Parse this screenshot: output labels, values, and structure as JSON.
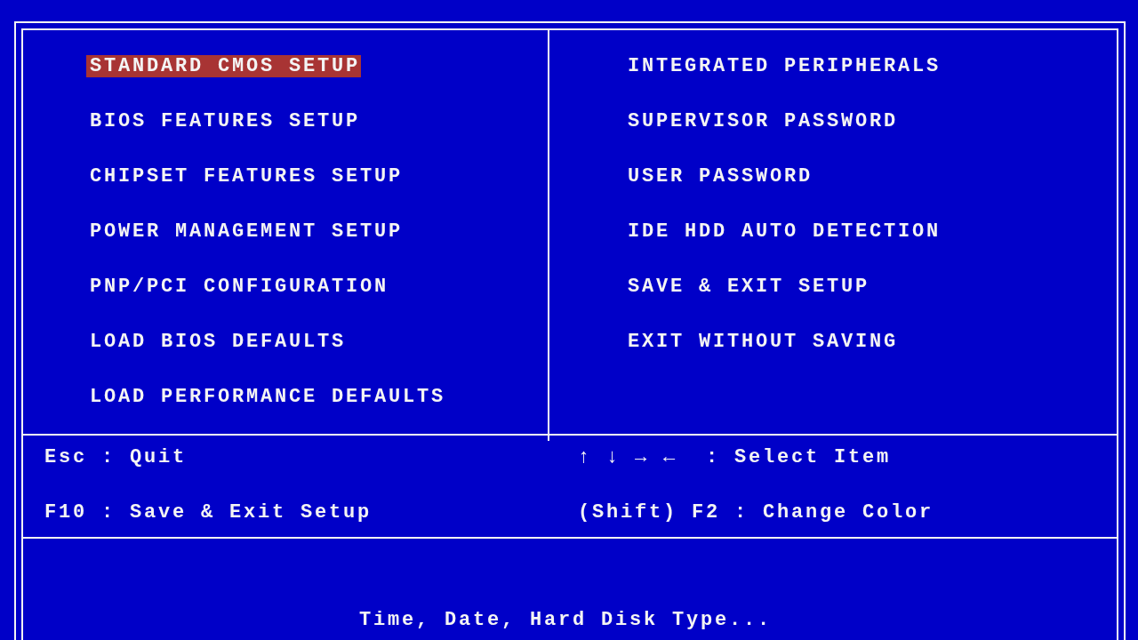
{
  "menu": {
    "left": [
      {
        "label": "STANDARD CMOS SETUP",
        "selected": true
      },
      {
        "label": "BIOS FEATURES SETUP",
        "selected": false
      },
      {
        "label": "CHIPSET FEATURES SETUP",
        "selected": false
      },
      {
        "label": "POWER MANAGEMENT SETUP",
        "selected": false
      },
      {
        "label": "PNP/PCI CONFIGURATION",
        "selected": false
      },
      {
        "label": "LOAD BIOS DEFAULTS",
        "selected": false
      },
      {
        "label": "LOAD PERFORMANCE DEFAULTS",
        "selected": false
      }
    ],
    "right": [
      {
        "label": "INTEGRATED PERIPHERALS",
        "selected": false
      },
      {
        "label": "SUPERVISOR PASSWORD",
        "selected": false
      },
      {
        "label": "USER PASSWORD",
        "selected": false
      },
      {
        "label": "IDE HDD AUTO DETECTION",
        "selected": false
      },
      {
        "label": "SAVE & EXIT SETUP",
        "selected": false
      },
      {
        "label": "EXIT WITHOUT SAVING",
        "selected": false
      }
    ]
  },
  "keys": [
    {
      "text": "Esc : Quit"
    },
    {
      "text": "↑ ↓ → ←  : Select Item"
    },
    {
      "text": "F10 : Save & Exit Setup"
    },
    {
      "text": "(Shift) F2 : Change Color"
    }
  ],
  "status_bar": "Time, Date, Hard Disk Type..."
}
